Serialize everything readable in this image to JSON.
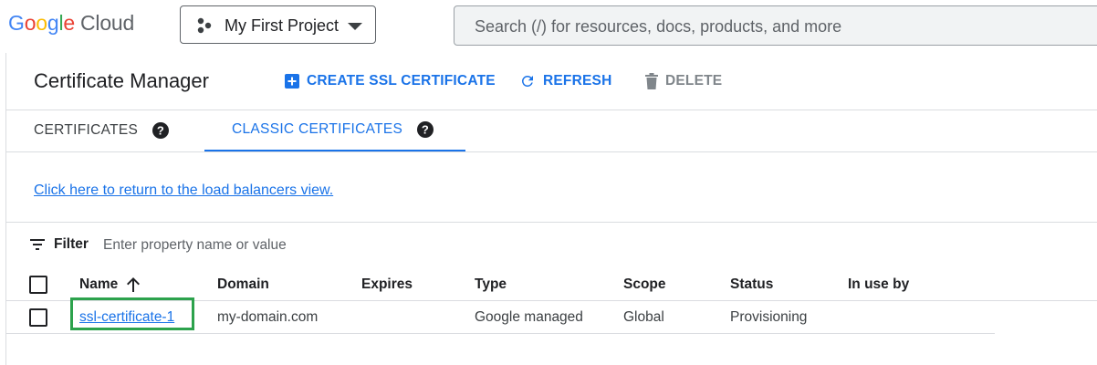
{
  "topbar": {
    "logo": {
      "g1": "G",
      "o1": "o",
      "o2": "o",
      "g2": "g",
      "l": "l",
      "e": "e",
      "cloud": "Cloud"
    },
    "project": "My First Project",
    "search_placeholder": "Search (/) for resources, docs, products, and more"
  },
  "header": {
    "title": "Certificate Manager",
    "create_label": "CREATE SSL CERTIFICATE",
    "refresh_label": "REFRESH",
    "delete_label": "DELETE"
  },
  "tabs": [
    {
      "label": "CERTIFICATES"
    },
    {
      "label": "CLASSIC CERTIFICATES",
      "active": true
    }
  ],
  "return_link": "Click here to return to the load balancers view.",
  "filter": {
    "label": "Filter",
    "placeholder": "Enter property name or value"
  },
  "table": {
    "columns": [
      "Name",
      "Domain",
      "Expires",
      "Type",
      "Scope",
      "Status",
      "In use by"
    ],
    "rows": [
      {
        "name": "ssl-certificate-1",
        "domain": "my-domain.com",
        "expires": "",
        "type": "Google managed",
        "scope": "Global",
        "status": "Provisioning",
        "in_use_by": ""
      }
    ]
  },
  "colors": {
    "accent": "#1a73e8",
    "highlight": "#2ca24c",
    "divider": "#dadce0"
  },
  "icons": [
    "project-dots-icon",
    "dropdown-caret-icon",
    "add-box-icon",
    "refresh-icon",
    "trash-icon",
    "help-icon",
    "filter-icon",
    "sort-arrow-up-icon",
    "checkbox-icon"
  ]
}
